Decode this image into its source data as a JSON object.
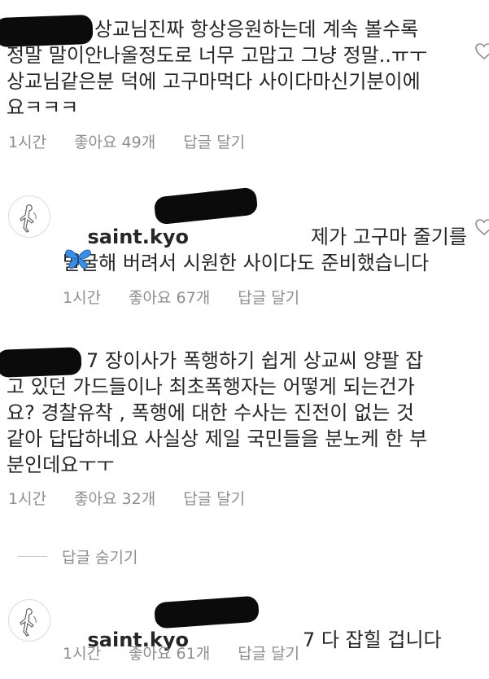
{
  "comments": [
    {
      "text": "상교님진짜 항상응원하는데 계속 볼수록\n정말 말이안나올정도로 너무 고맙고 그냥 정말..ㅠㅜ\n상교님같은분 덕에 고구마먹다 사이다마신기분이에\n요ㅋㅋㅋ",
      "time": "1시간",
      "likes": "좋아요 49개",
      "reply": "답글 달기"
    },
    {
      "username": "saint.kyo",
      "text": "제가 고구마 줄기를\n발굴해 버려서 시원한 사이다도 준비했습니다",
      "emoji": "butterfly",
      "time": "1시간",
      "likes": "좋아요 67개",
      "reply": "답글 달기"
    },
    {
      "text": "7 장이사가 폭행하기 쉽게 상교씨 양팔 잡\n고 있던 가드들이나 최초폭행자는 어떻게 되는건가\n요? 경찰유착 , 폭행에 대한 수사는 진전이 없는 것\n같아 답답하네요 사실상 제일 국민들을 분노케 한 부\n분인데요ㅜㅜ",
      "time": "1시간",
      "likes": "좋아요 32개",
      "reply": "답글 달기"
    },
    {
      "username": "saint.kyo",
      "text": "7 다 잡힐 겁니다",
      "time": "1시간",
      "likes": "좋아요 61개",
      "reply": "답글 달기"
    }
  ],
  "hide_replies": "답글 숨기기",
  "icons": {
    "heart": "heart-outline-icon",
    "avatar": "avatar-saint-kyo",
    "emoji": "blue-butterfly-emoji"
  },
  "colors": {
    "text": "#262626",
    "meta": "#8e8e8e",
    "butterfly": "#3a8ee6",
    "redaction": "#0b0b0b"
  }
}
